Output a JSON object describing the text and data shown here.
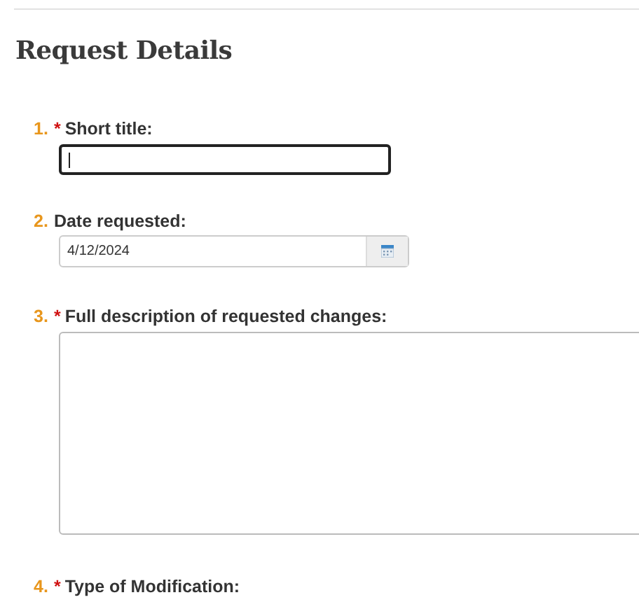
{
  "section": {
    "title": "Request Details"
  },
  "questions": [
    {
      "number": "1.",
      "required_mark": "*",
      "label": "Short title:",
      "kind": "text",
      "focused": true
    },
    {
      "number": "2.",
      "label": "Date requested:",
      "kind": "date",
      "value": "4/12/2024",
      "focused": false
    },
    {
      "number": "3.",
      "required_mark": "*",
      "label": "Full description of requested changes:",
      "kind": "textarea",
      "focused": false
    },
    {
      "number": "4.",
      "required_mark": "*",
      "label": "Type of Modification:",
      "kind": "none"
    }
  ]
}
